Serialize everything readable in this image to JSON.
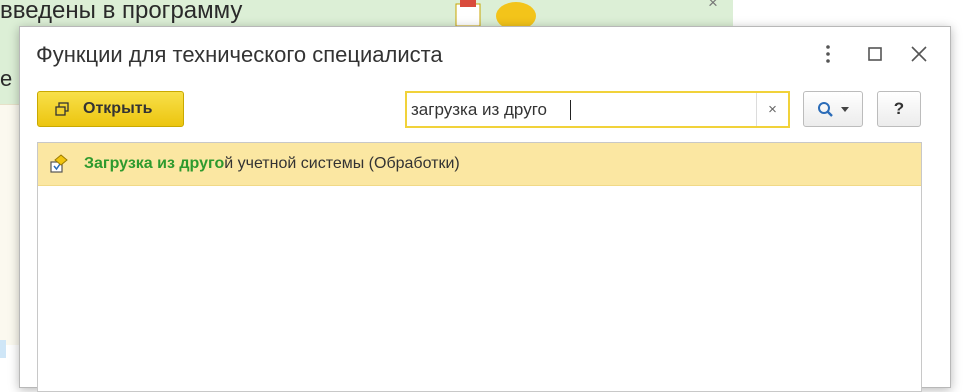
{
  "background": {
    "banner_text": "введены в программу",
    "left_letter": "е"
  },
  "dialog": {
    "title": "Функции для технического специалиста",
    "open_button_label": "Открыть",
    "search": {
      "value": "загрузка из друго",
      "clear_symbol": "×"
    },
    "help_label": "?",
    "results": [
      {
        "match": "Загрузка из друго",
        "rest": "й учетной системы (Обработки)"
      }
    ]
  },
  "colors": {
    "accent_yellow": "#f1d23a",
    "selected_row": "#fbe7a2",
    "match_green": "#2e9a2e",
    "banner_green": "#dcefd6"
  },
  "icons": {
    "open": "open-icon",
    "search": "magnifier-icon",
    "row": "data-processor-icon",
    "window_menu": "kebab-icon",
    "maximize": "maximize-icon",
    "close": "close-icon"
  }
}
